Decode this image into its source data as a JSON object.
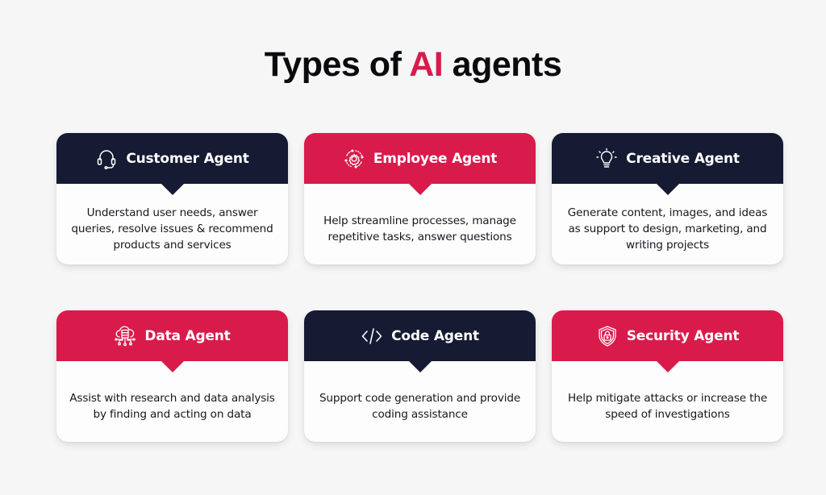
{
  "title": {
    "prefix": "Types of ",
    "accent": "AI",
    "suffix": " agents"
  },
  "colors": {
    "accent": "#d91b4b",
    "dark": "#161a32",
    "background": "#f6f6f6"
  },
  "cards": [
    {
      "title": "Customer Agent",
      "icon": "headset-icon",
      "theme": "dark",
      "description": "Understand user needs, answer queries, resolve issues & recommend products and services"
    },
    {
      "title": "Employee Agent",
      "icon": "gear-cycle-icon",
      "theme": "red",
      "description": "Help streamline processes, manage repetitive tasks, answer questions"
    },
    {
      "title": "Creative Agent",
      "icon": "lightbulb-icon",
      "theme": "dark",
      "description": "Generate content, images, and ideas as support to design, marketing, and writing projects"
    },
    {
      "title": "Data Agent",
      "icon": "cloud-server-icon",
      "theme": "red",
      "description": "Assist with research and data analysis by finding and acting on data"
    },
    {
      "title": "Code Agent",
      "icon": "code-icon",
      "theme": "dark",
      "description": "Support code generation and provide coding assistance"
    },
    {
      "title": "Security Agent",
      "icon": "shield-lock-icon",
      "theme": "red",
      "description": "Help mitigate attacks or increase the speed of investigations"
    }
  ]
}
